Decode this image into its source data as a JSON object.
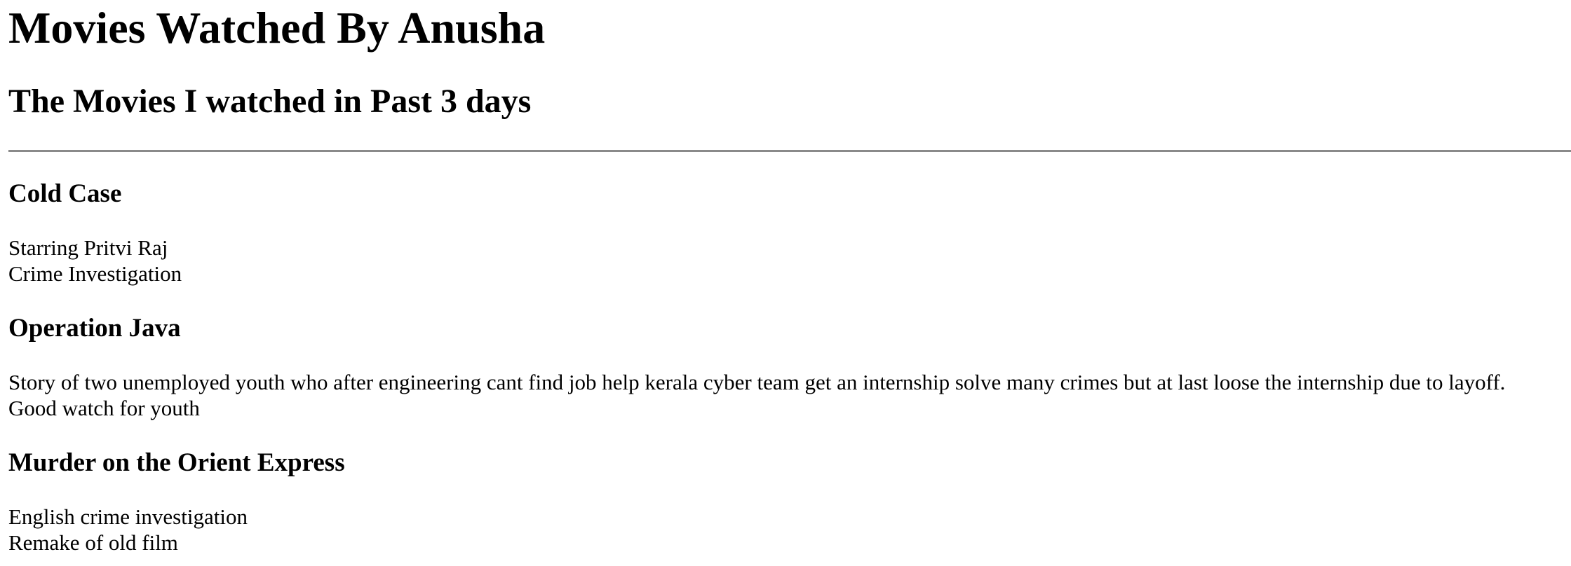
{
  "page": {
    "title": "Movies Watched By Anusha",
    "subtitle": "The Movies I watched in Past 3 days"
  },
  "movies": [
    {
      "title": "Cold Case",
      "lines": [
        "Starring Pritvi Raj",
        "Crime Investigation"
      ]
    },
    {
      "title": "Operation Java",
      "lines": [
        "Story of two unemployed youth who after engineering cant find job help kerala cyber team get an internship solve many crimes but at last loose the internship due to layoff.",
        "Good watch for youth"
      ]
    },
    {
      "title": "Murder on the Orient Express",
      "lines": [
        "English crime investigation",
        "Remake of old film"
      ]
    }
  ]
}
